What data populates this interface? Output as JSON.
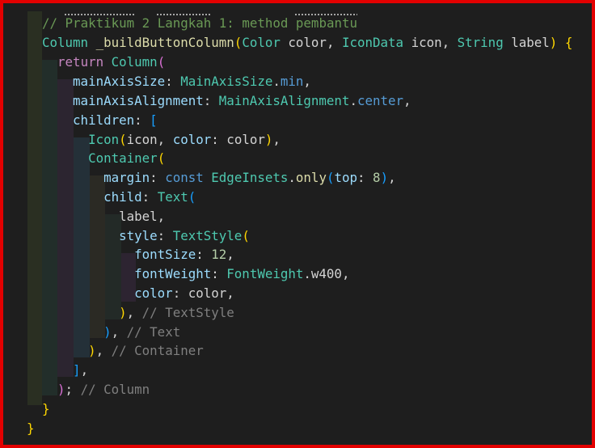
{
  "editor": {
    "lines": [
      {
        "tokens": [
          {
            "c": "cm",
            "t": "// "
          },
          {
            "c": "cm dotted",
            "t": "Praktikum"
          },
          {
            "c": "cm",
            "t": " 2 "
          },
          {
            "c": "cm dotted",
            "t": "Langkah"
          },
          {
            "c": "cm",
            "t": " 1: method "
          },
          {
            "c": "cm dotted",
            "t": "pembantu"
          }
        ]
      },
      {
        "tokens": [
          {
            "c": "ty",
            "t": "Column"
          },
          {
            "c": "plain",
            "t": " "
          },
          {
            "c": "fn",
            "t": "_buildButtonColumn"
          },
          {
            "c": "b1",
            "t": "("
          },
          {
            "c": "ty",
            "t": "Color"
          },
          {
            "c": "plain",
            "t": " color, "
          },
          {
            "c": "ty",
            "t": "IconData"
          },
          {
            "c": "plain",
            "t": " icon, "
          },
          {
            "c": "ty",
            "t": "String"
          },
          {
            "c": "plain",
            "t": " label"
          },
          {
            "c": "b1",
            "t": ")"
          },
          {
            "c": "plain",
            "t": " "
          },
          {
            "c": "b1",
            "t": "{"
          }
        ]
      },
      {
        "tokens": [
          {
            "c": "plain",
            "t": "  "
          },
          {
            "c": "kwc",
            "t": "return"
          },
          {
            "c": "plain",
            "t": " "
          },
          {
            "c": "ty",
            "t": "Column"
          },
          {
            "c": "b2",
            "t": "("
          }
        ]
      },
      {
        "tokens": [
          {
            "c": "plain",
            "t": "    "
          },
          {
            "c": "pr",
            "t": "mainAxisSize"
          },
          {
            "c": "plain",
            "t": ": "
          },
          {
            "c": "ty",
            "t": "MainAxisSize"
          },
          {
            "c": "plain",
            "t": "."
          },
          {
            "c": "kw",
            "t": "min"
          },
          {
            "c": "plain",
            "t": ","
          }
        ]
      },
      {
        "tokens": [
          {
            "c": "plain",
            "t": "    "
          },
          {
            "c": "pr",
            "t": "mainAxisAlignment"
          },
          {
            "c": "plain",
            "t": ": "
          },
          {
            "c": "ty",
            "t": "MainAxisAlignment"
          },
          {
            "c": "plain",
            "t": "."
          },
          {
            "c": "kw",
            "t": "center"
          },
          {
            "c": "plain",
            "t": ","
          }
        ]
      },
      {
        "tokens": [
          {
            "c": "plain",
            "t": "    "
          },
          {
            "c": "pr",
            "t": "children"
          },
          {
            "c": "plain",
            "t": ": "
          },
          {
            "c": "b3",
            "t": "["
          }
        ]
      },
      {
        "tokens": [
          {
            "c": "plain",
            "t": "      "
          },
          {
            "c": "ty",
            "t": "Icon"
          },
          {
            "c": "b1",
            "t": "("
          },
          {
            "c": "plain",
            "t": "icon, "
          },
          {
            "c": "pr",
            "t": "color"
          },
          {
            "c": "plain",
            "t": ": color"
          },
          {
            "c": "b1",
            "t": ")"
          },
          {
            "c": "plain",
            "t": ","
          }
        ]
      },
      {
        "tokens": [
          {
            "c": "plain",
            "t": "      "
          },
          {
            "c": "ty",
            "t": "Container"
          },
          {
            "c": "b1",
            "t": "("
          }
        ]
      },
      {
        "tokens": [
          {
            "c": "plain",
            "t": "        "
          },
          {
            "c": "pr",
            "t": "margin"
          },
          {
            "c": "plain",
            "t": ": "
          },
          {
            "c": "kw",
            "t": "const"
          },
          {
            "c": "plain",
            "t": " "
          },
          {
            "c": "ty",
            "t": "EdgeInsets"
          },
          {
            "c": "plain",
            "t": "."
          },
          {
            "c": "fn",
            "t": "only"
          },
          {
            "c": "b3",
            "t": "("
          },
          {
            "c": "pr",
            "t": "top"
          },
          {
            "c": "plain",
            "t": ": "
          },
          {
            "c": "num",
            "t": "8"
          },
          {
            "c": "b3",
            "t": ")"
          },
          {
            "c": "plain",
            "t": ","
          }
        ]
      },
      {
        "tokens": [
          {
            "c": "plain",
            "t": "        "
          },
          {
            "c": "pr",
            "t": "child"
          },
          {
            "c": "plain",
            "t": ": "
          },
          {
            "c": "ty",
            "t": "Text"
          },
          {
            "c": "b3",
            "t": "("
          }
        ]
      },
      {
        "tokens": [
          {
            "c": "plain",
            "t": "          label,"
          }
        ]
      },
      {
        "tokens": [
          {
            "c": "plain",
            "t": "          "
          },
          {
            "c": "pr",
            "t": "style"
          },
          {
            "c": "plain",
            "t": ": "
          },
          {
            "c": "ty",
            "t": "TextStyle"
          },
          {
            "c": "b1",
            "t": "("
          }
        ]
      },
      {
        "tokens": [
          {
            "c": "plain",
            "t": "            "
          },
          {
            "c": "pr",
            "t": "fontSize"
          },
          {
            "c": "plain",
            "t": ": "
          },
          {
            "c": "num",
            "t": "12"
          },
          {
            "c": "plain",
            "t": ","
          }
        ]
      },
      {
        "tokens": [
          {
            "c": "plain",
            "t": "            "
          },
          {
            "c": "pr",
            "t": "fontWeight"
          },
          {
            "c": "plain",
            "t": ": "
          },
          {
            "c": "ty",
            "t": "FontWeight"
          },
          {
            "c": "plain",
            "t": ".w400,"
          }
        ]
      },
      {
        "tokens": [
          {
            "c": "plain",
            "t": "            "
          },
          {
            "c": "pr",
            "t": "color"
          },
          {
            "c": "plain",
            "t": ": color,"
          }
        ]
      },
      {
        "tokens": [
          {
            "c": "plain",
            "t": "          "
          },
          {
            "c": "b1",
            "t": ")"
          },
          {
            "c": "plain",
            "t": ", "
          },
          {
            "c": "cmg",
            "t": "// TextStyle"
          }
        ]
      },
      {
        "tokens": [
          {
            "c": "plain",
            "t": "        "
          },
          {
            "c": "b3",
            "t": ")"
          },
          {
            "c": "plain",
            "t": ", "
          },
          {
            "c": "cmg",
            "t": "// Text"
          }
        ]
      },
      {
        "tokens": [
          {
            "c": "plain",
            "t": "      "
          },
          {
            "c": "b1",
            "t": ")"
          },
          {
            "c": "plain",
            "t": ", "
          },
          {
            "c": "cmg",
            "t": "// Container"
          }
        ]
      },
      {
        "tokens": [
          {
            "c": "plain",
            "t": "    "
          },
          {
            "c": "b3",
            "t": "]"
          },
          {
            "c": "plain",
            "t": ","
          }
        ]
      },
      {
        "tokens": [
          {
            "c": "plain",
            "t": "  "
          },
          {
            "c": "b2",
            "t": ")"
          },
          {
            "c": "plain",
            "t": "; "
          },
          {
            "c": "cmg",
            "t": "// Column"
          }
        ]
      },
      {
        "tokens": [
          {
            "c": "b1",
            "t": "}"
          }
        ]
      },
      {
        "tokens": [
          {
            "c": "b1",
            "t": "}"
          }
        ]
      }
    ]
  }
}
